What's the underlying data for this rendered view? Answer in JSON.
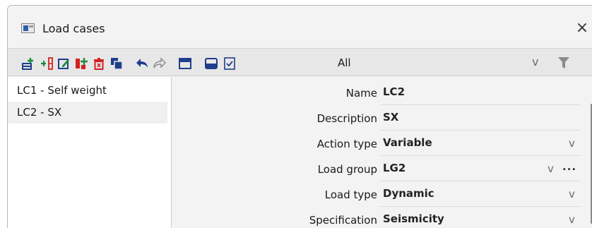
{
  "window": {
    "title": "Load cases",
    "close_label": "×"
  },
  "toolbar": {
    "icons": [
      "add-icon",
      "insert-icon",
      "edit-icon",
      "copy-icon",
      "delete-icon",
      "duplicate-icon",
      "undo-icon",
      "redo-icon",
      "table-icon",
      "open-icon",
      "check-icon"
    ],
    "filter_value": "All",
    "filter_chevron": "v",
    "filter_icon": "funnel-icon"
  },
  "list": {
    "items": [
      {
        "label": "LC1 - Self weight"
      },
      {
        "label": "LC2 - SX"
      }
    ],
    "selected_index": 1
  },
  "properties": {
    "rows": [
      {
        "label": "Name",
        "value": "LC2"
      },
      {
        "label": "Description",
        "value": "SX"
      },
      {
        "label": "Action type",
        "value": "Variable",
        "dropdown": "v"
      },
      {
        "label": "Load group",
        "value": "LG2",
        "dropdown": "v",
        "more": "..."
      },
      {
        "label": "Load type",
        "value": "Dynamic",
        "dropdown": "v"
      },
      {
        "label": "Specification",
        "value": "Seismicity",
        "dropdown": "v"
      }
    ]
  },
  "colors": {
    "accent_red": "#d42020",
    "accent_green": "#1e8a3c",
    "accent_blue": "#1f3f8c"
  }
}
